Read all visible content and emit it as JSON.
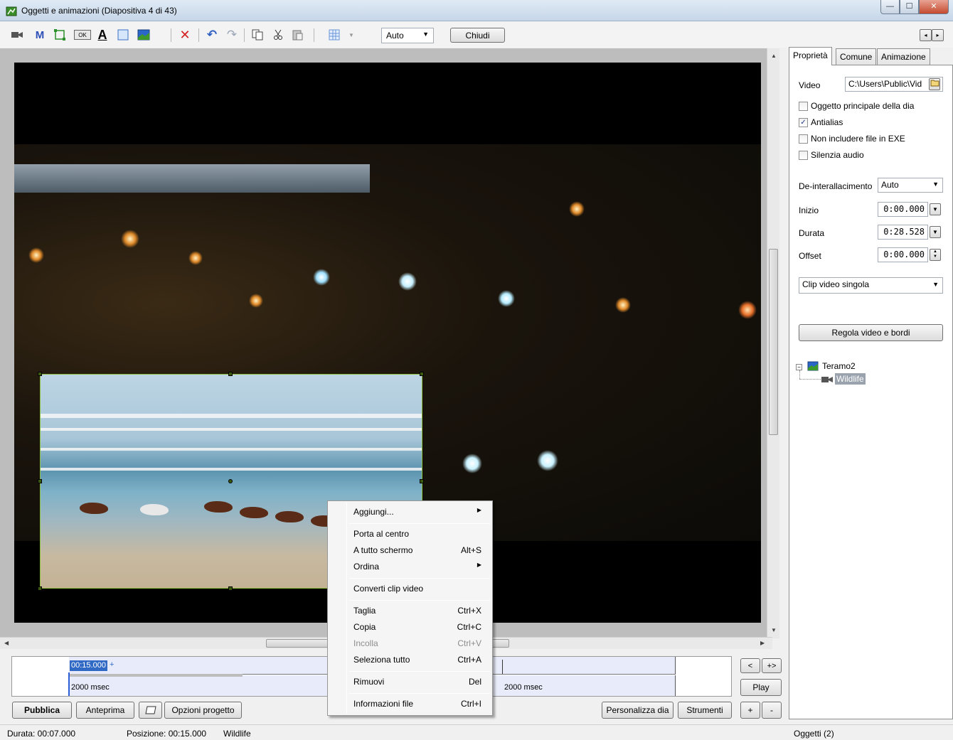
{
  "window": {
    "title": "Oggetti e animazioni  (Diapositiva 4 di 43)",
    "minimize_icon": "minimize-icon",
    "maximize_icon": "maximize-icon",
    "close_icon": "close-icon",
    "min_glyph": "—",
    "max_glyph": "☐",
    "close_glyph": "✕"
  },
  "toolbar": {
    "icons": [
      "video-camera-icon",
      "mask-icon",
      "rectangle-icon",
      "button-icon",
      "text-icon",
      "frame-icon",
      "image-icon",
      "delete-icon",
      "undo-icon",
      "redo-icon",
      "copy-icon",
      "cut-icon",
      "paste-icon",
      "grid-icon"
    ],
    "mask_glyph": "M",
    "ok_glyph": "OK",
    "text_glyph": "A",
    "delete_glyph": "✕",
    "undo_glyph": "↶",
    "redo_glyph": "↷",
    "zoom_value": "Auto",
    "close_label": "Chiudi",
    "nav_left": "◂",
    "nav_right": "▸"
  },
  "timeline": {
    "position_tag": "00:15.000",
    "position_sign": "+",
    "duration_left": "2000 msec",
    "duration_right": "2000 msec",
    "btn_left": "<",
    "btn_right": "+>",
    "play_label": "Play"
  },
  "bottom_buttons": {
    "publish": "Pubblica",
    "preview": "Anteprima",
    "project_options": "Opzioni progetto",
    "customize_slide": "Personalizza dia",
    "tools": "Strumenti",
    "plus": "+",
    "minus": "-"
  },
  "status": {
    "duration": "Durata:  00:07.000",
    "position": "Posizione:  00:15.000",
    "object_name": "Wildlife",
    "objects_count": "Oggetti (2)"
  },
  "properties": {
    "tabs": [
      "Proprietà",
      "Comune",
      "Animazione"
    ],
    "video_label": "Video",
    "video_path": "C:\\Users\\Public\\Vid",
    "checkboxes": [
      {
        "label": "Oggetto principale della dia",
        "checked": false
      },
      {
        "label": "Antialias",
        "checked": true
      },
      {
        "label": "Non includere file in EXE",
        "checked": false
      },
      {
        "label": "Silenzia audio",
        "checked": false
      }
    ],
    "deinterlace_label": "De-interallacimento",
    "deinterlace_value": "Auto",
    "start_label": "Inizio",
    "start_value": "0:00.000",
    "duration_label": "Durata",
    "duration_value": "0:28.528",
    "offset_label": "Offset",
    "offset_value": "0:00.000",
    "clip_mode": "Clip video singola",
    "adjust_button": "Regola video e bordi"
  },
  "tree": {
    "root": "Teramo2",
    "child": "Wildlife"
  },
  "context_menu": {
    "items": [
      {
        "label": "Aggiungi...",
        "shortcut": "",
        "submenu": true,
        "disabled": false
      },
      {
        "label": "Porta al centro",
        "shortcut": "",
        "submenu": false,
        "disabled": false
      },
      {
        "label": "A tutto schermo",
        "shortcut": "Alt+S",
        "submenu": false,
        "disabled": false
      },
      {
        "label": "Ordina",
        "shortcut": "",
        "submenu": true,
        "disabled": false
      },
      {
        "label": "Converti clip video",
        "shortcut": "",
        "submenu": false,
        "disabled": false
      },
      {
        "label": "Taglia",
        "shortcut": "Ctrl+X",
        "submenu": false,
        "disabled": false
      },
      {
        "label": "Copia",
        "shortcut": "Ctrl+C",
        "submenu": false,
        "disabled": false
      },
      {
        "label": "Incolla",
        "shortcut": "Ctrl+V",
        "submenu": false,
        "disabled": true
      },
      {
        "label": "Seleziona tutto",
        "shortcut": "Ctrl+A",
        "submenu": false,
        "disabled": false
      },
      {
        "label": "Rimuovi",
        "shortcut": "Del",
        "submenu": false,
        "disabled": false
      },
      {
        "label": "Informazioni file",
        "shortcut": "Ctrl+I",
        "submenu": false,
        "disabled": false
      }
    ],
    "submenu_glyph": "▶"
  },
  "colors": {
    "selection_green": "#8dbf3e",
    "timeline_highlight": "#316ac5"
  }
}
